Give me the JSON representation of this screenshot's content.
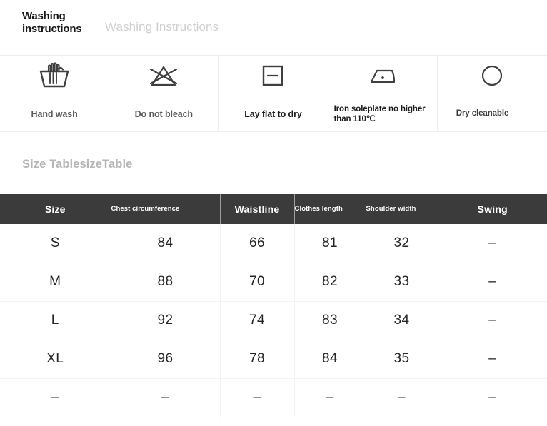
{
  "washing": {
    "heading_primary_line1": "Washing",
    "heading_primary_line2": "instructions",
    "heading_secondary": "Washing Instructions",
    "cells": [
      {
        "icon": "hand-wash-icon",
        "label": "Hand wash",
        "style": "center"
      },
      {
        "icon": "do-not-bleach-icon",
        "label": "Do not bleach",
        "style": "center"
      },
      {
        "icon": "lay-flat-to-dry-icon",
        "label": "Lay flat to dry",
        "style": "center-dark"
      },
      {
        "icon": "iron-low-heat-icon",
        "label": "Iron soleplate no higher than 110℃",
        "style": "left-dark"
      },
      {
        "icon": "dry-cleanable-icon",
        "label": "Dry cleanable",
        "style": "left-indent"
      }
    ]
  },
  "size_table": {
    "heading": "Size TablesizeTable",
    "columns": [
      {
        "label": "Size",
        "style": "big"
      },
      {
        "label": "Chest circumference",
        "style": "small"
      },
      {
        "label": "Waistline",
        "style": "big"
      },
      {
        "label": "Clothes length",
        "style": "small"
      },
      {
        "label": "Shoulder width",
        "style": "small"
      },
      {
        "label": "Swing",
        "style": "big"
      }
    ],
    "rows": [
      [
        "S",
        "84",
        "66",
        "81",
        "32",
        "–"
      ],
      [
        "M",
        "88",
        "70",
        "82",
        "33",
        "–"
      ],
      [
        "L",
        "92",
        "74",
        "83",
        "34",
        "–"
      ],
      [
        "XL",
        "96",
        "78",
        "84",
        "35",
        "–"
      ],
      [
        "–",
        "–",
        "–",
        "–",
        "–",
        "–"
      ]
    ]
  },
  "colors": {
    "header_bg": "#3b3b3b",
    "header_text": "#ffffff",
    "grid_line": "#f3f3f3",
    "muted_text": "#b6b6b6",
    "icon_stroke": "#3f3f3f"
  }
}
